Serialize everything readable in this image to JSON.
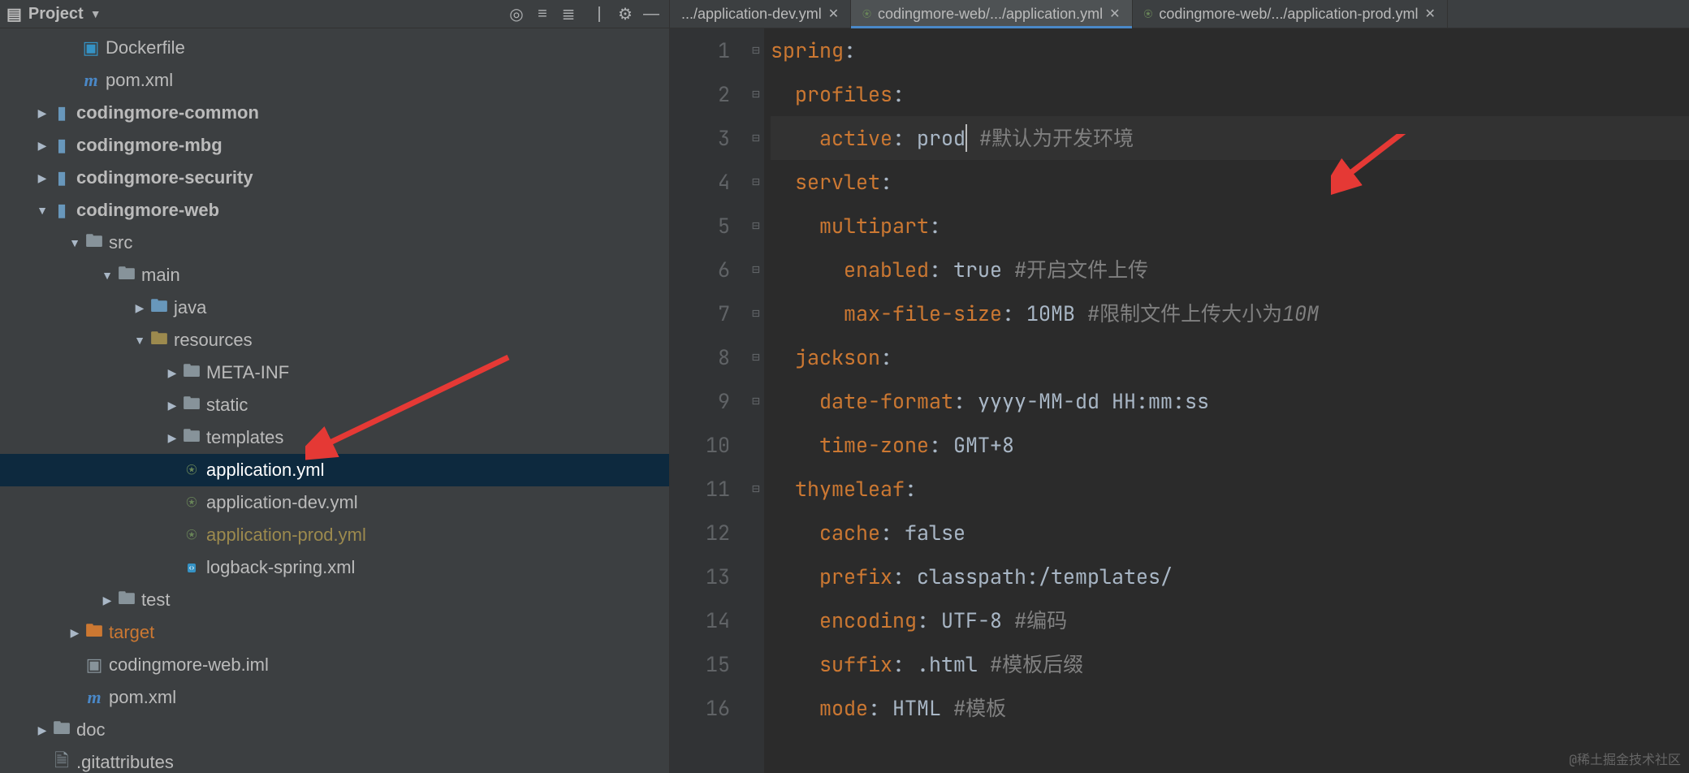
{
  "project": {
    "headerTitle": "Project",
    "tree": {
      "dockerfile": "Dockerfile",
      "pom1": "pom.xml",
      "common": "codingmore-common",
      "mbg": "codingmore-mbg",
      "security": "codingmore-security",
      "web": "codingmore-web",
      "src": "src",
      "main": "main",
      "java": "java",
      "resources": "resources",
      "metainf": "META-INF",
      "static": "static",
      "templates": "templates",
      "appYml": "application.yml",
      "appDevYml": "application-dev.yml",
      "appProdYml": "application-prod.yml",
      "logback": "logback-spring.xml",
      "test": "test",
      "target": "target",
      "iml": "codingmore-web.iml",
      "pom2": "pom.xml",
      "doc": "doc",
      "gitattr": ".gitattributes"
    }
  },
  "tabs": {
    "t1": ".../application-dev.yml",
    "t2": "codingmore-web/.../application.yml",
    "t3": "codingmore-web/.../application-prod.yml"
  },
  "code": {
    "l1": {
      "k": "spring",
      "p": ":"
    },
    "l2": {
      "k": "profiles",
      "p": ":"
    },
    "l3": {
      "k": "active",
      "p": ": ",
      "v": "prod",
      "cm": " #默认为开发环境"
    },
    "l4": {
      "k": "servlet",
      "p": ":"
    },
    "l5": {
      "k": "multipart",
      "p": ":"
    },
    "l6": {
      "k": "enabled",
      "p": ": ",
      "v": "true",
      "cm": " #开启文件上传"
    },
    "l7": {
      "k": "max-file-size",
      "p": ": ",
      "v": "10MB",
      "cm1": " #限制文件上传大小为",
      "cm2": "10M"
    },
    "l8": {
      "k": "jackson",
      "p": ":"
    },
    "l9": {
      "k": "date-format",
      "p": ": ",
      "v": "yyyy-MM-dd HH:mm:ss"
    },
    "l10": {
      "k": "time-zone",
      "p": ": ",
      "v": "GMT+8"
    },
    "l11": {
      "k": "thymeleaf",
      "p": ":"
    },
    "l12": {
      "k": "cache",
      "p": ": ",
      "v": "false"
    },
    "l13": {
      "k": "prefix",
      "p": ": ",
      "v": "classpath:/templates/"
    },
    "l14": {
      "k": "encoding",
      "p": ": ",
      "v": "UTF-8",
      "cm": " #编码"
    },
    "l15": {
      "k": "suffix",
      "p": ": ",
      "v": ".html",
      "cm": " #模板后缀"
    },
    "l16": {
      "k": "mode",
      "p": ": ",
      "v": "HTML",
      "cm": " #模板"
    }
  },
  "gutter": {
    "n1": "1",
    "n2": "2",
    "n3": "3",
    "n4": "4",
    "n5": "5",
    "n6": "6",
    "n7": "7",
    "n8": "8",
    "n9": "9",
    "n10": "10",
    "n11": "11",
    "n12": "12",
    "n13": "13",
    "n14": "14",
    "n15": "15",
    "n16": "16"
  },
  "watermark": "@稀土掘金技术社区"
}
